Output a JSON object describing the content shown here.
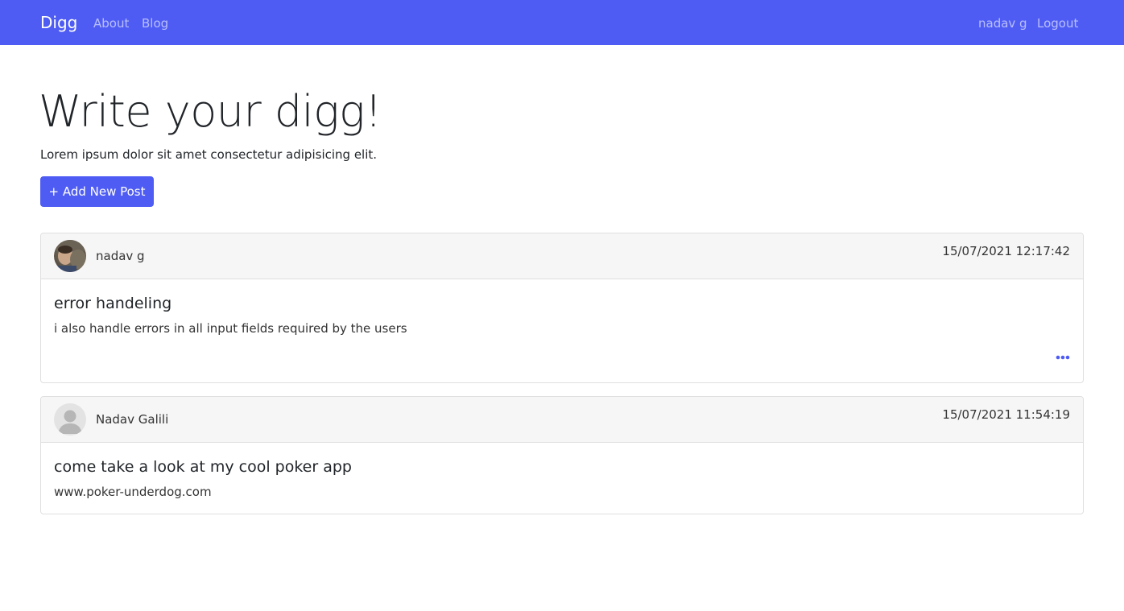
{
  "navbar": {
    "brand": "Digg",
    "links": [
      {
        "label": "About"
      },
      {
        "label": "Blog"
      }
    ],
    "user": "nadav g",
    "logout": "Logout",
    "accent_color": "#4e5cf4"
  },
  "hero": {
    "title": "Write your digg!",
    "subtitle": "Lorem ipsum dolor sit amet consectetur adipisicing elit.",
    "add_button_label": "+ Add New Post"
  },
  "posts": [
    {
      "author": "nadav g",
      "avatar": "photo-avatar",
      "timestamp": "15/07/2021 12:17:42",
      "title": "error handeling",
      "body": "i also handle errors in all input fields required by the users",
      "has_menu": true,
      "menu_icon": "more-horizontal-icon"
    },
    {
      "author": "Nadav Galili",
      "avatar": "default-user-avatar",
      "timestamp": "15/07/2021 11:54:19",
      "title": "come take a look at my cool poker app",
      "body": "www.poker-underdog.com",
      "has_menu": false
    }
  ]
}
